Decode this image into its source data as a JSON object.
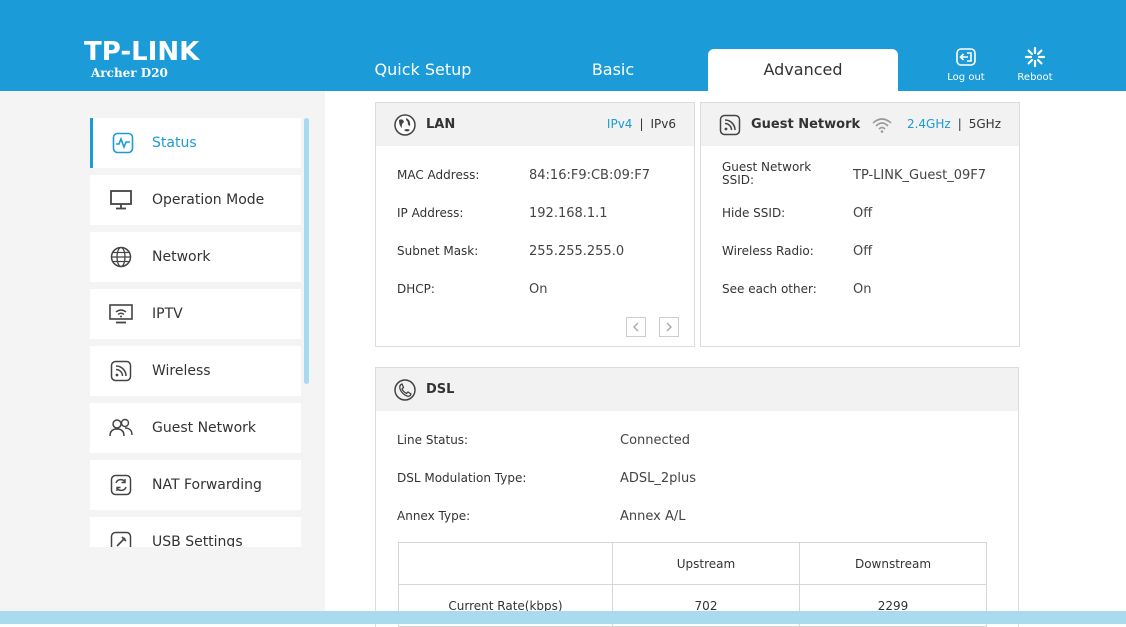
{
  "brand": {
    "logo": "TP-LINK",
    "model": "Archer D20"
  },
  "tabs": [
    {
      "label": "Quick Setup",
      "active": false
    },
    {
      "label": "Basic",
      "active": false
    },
    {
      "label": "Advanced",
      "active": true
    }
  ],
  "header_buttons": {
    "logout": "Log out",
    "reboot": "Reboot"
  },
  "sidebar": {
    "items": [
      {
        "label": "Status",
        "icon": "status-icon",
        "active": true
      },
      {
        "label": "Operation Mode",
        "icon": "monitor-icon"
      },
      {
        "label": "Network",
        "icon": "globe-icon"
      },
      {
        "label": "IPTV",
        "icon": "iptv-icon"
      },
      {
        "label": "Wireless",
        "icon": "wireless-icon"
      },
      {
        "label": "Guest Network",
        "icon": "guest-users-icon"
      },
      {
        "label": "NAT Forwarding",
        "icon": "nat-forwarding-icon"
      },
      {
        "label": "USB Settings",
        "icon": "usb-settings-icon"
      }
    ]
  },
  "lan": {
    "title": "LAN",
    "ipv4": "IPv4",
    "separator": "|",
    "ipv6": "IPv6",
    "rows": [
      {
        "label": "MAC Address:",
        "value": "84:16:F9:CB:09:F7"
      },
      {
        "label": "IP Address:",
        "value": "192.168.1.1"
      },
      {
        "label": "Subnet Mask:",
        "value": "255.255.255.0"
      },
      {
        "label": "DHCP:",
        "value": "On"
      }
    ]
  },
  "guest": {
    "title": "Guest Network",
    "band24": "2.4GHz",
    "separator": "|",
    "band5": "5GHz",
    "ssid_label_line1": "Guest Network",
    "ssid_label_line2": "SSID:",
    "ssid_value": "TP-LINK_Guest_09F7",
    "rows": [
      {
        "label": "Hide SSID:",
        "value": "Off"
      },
      {
        "label": "Wireless Radio:",
        "value": "Off"
      },
      {
        "label": "See each other:",
        "value": "On"
      }
    ]
  },
  "dsl": {
    "title": "DSL",
    "rows": [
      {
        "label": "Line Status:",
        "value": "Connected"
      },
      {
        "label": "DSL Modulation Type:",
        "value": "ADSL_2plus"
      },
      {
        "label": "Annex Type:",
        "value": "Annex A/L"
      }
    ],
    "table": {
      "headers": [
        "",
        "Upstream",
        "Downstream"
      ],
      "rows": [
        [
          "Current Rate(kbps)",
          "702",
          "2299"
        ]
      ]
    }
  },
  "colors": {
    "accent": "#1b9bd7",
    "header_bg": "#1b9bd7",
    "sidebar_bg": "#f4f4f4"
  }
}
